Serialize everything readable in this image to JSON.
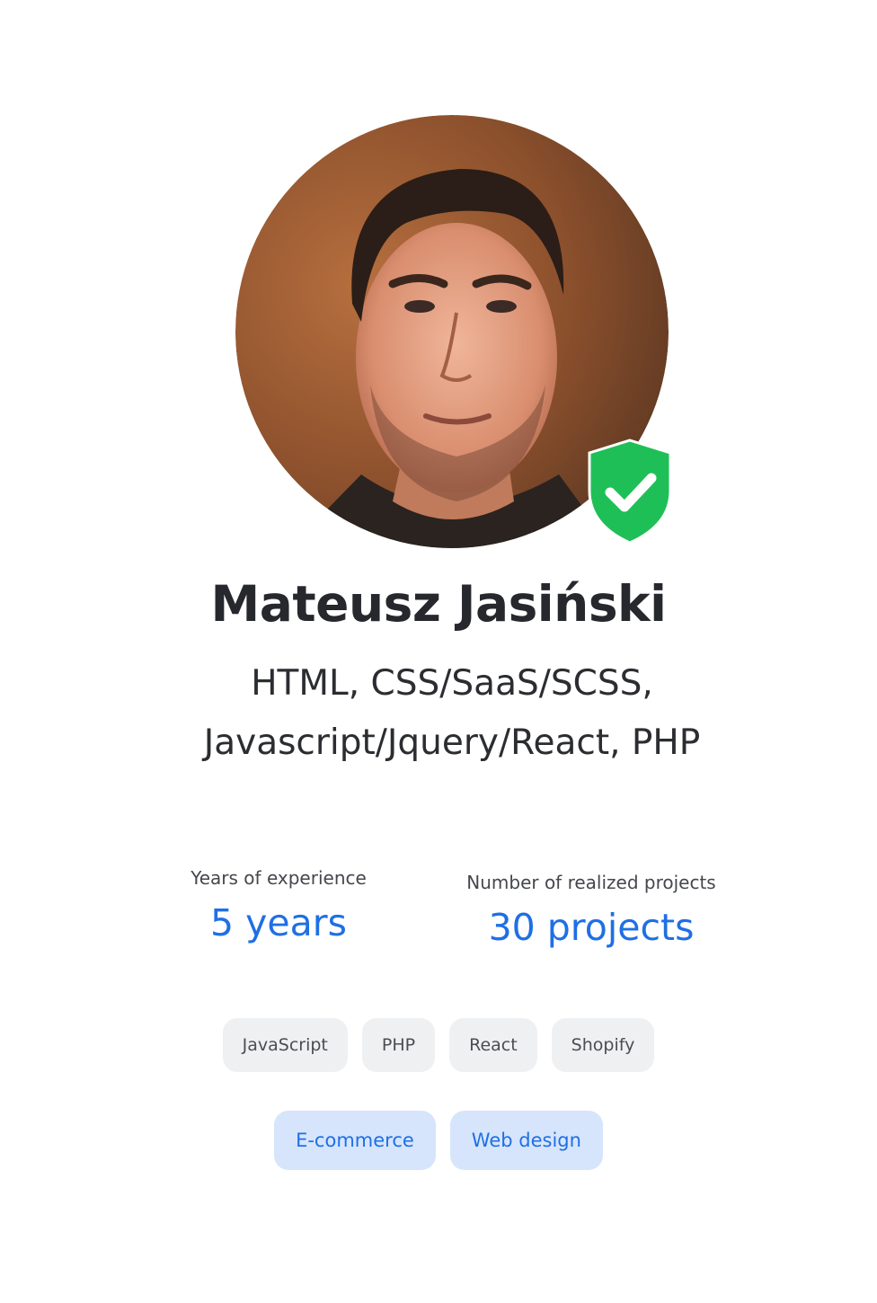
{
  "profile": {
    "name": "Mateusz Jasiński",
    "skills": "HTML, CSS/SaaS/SCSS, Javascript/Jquery/React, PHP",
    "verified_icon": "verified-shield-check-icon"
  },
  "stats": {
    "experience_label": "Years of experience",
    "experience_value": "5 years",
    "projects_label": "Number of realized projects",
    "projects_value": "30 projects"
  },
  "tech_tags": [
    "JavaScript",
    "PHP",
    "React",
    "Shopify"
  ],
  "category_tags": [
    "E-commerce",
    "Web design"
  ],
  "colors": {
    "accent": "#1f6fe5",
    "verified_green": "#1fbf57",
    "tag_bg": "#eff0f2",
    "accent_tag_bg": "#d6e5fb",
    "name_text": "#26282d"
  }
}
